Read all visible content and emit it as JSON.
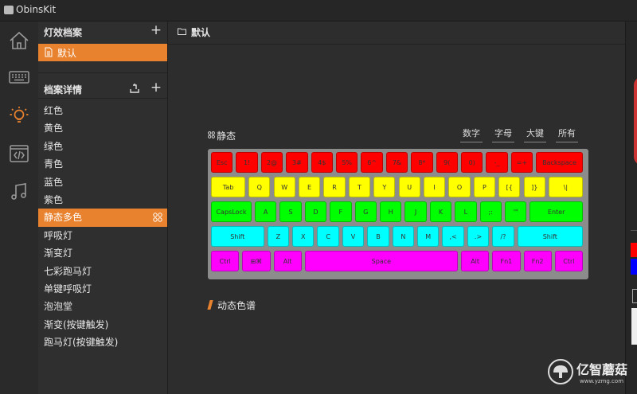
{
  "app": {
    "title": "ObinsKit"
  },
  "nav": [
    {
      "name": "home-icon"
    },
    {
      "name": "keyboard-icon"
    },
    {
      "name": "lightbulb-icon",
      "active": true
    },
    {
      "name": "code-icon"
    },
    {
      "name": "music-note-icon"
    }
  ],
  "profiles": {
    "title": "灯效档案",
    "add": "+",
    "items": [
      "默认"
    ]
  },
  "details": {
    "title": "档案详情",
    "add": "+",
    "effects": [
      "红色",
      "黄色",
      "绿色",
      "青色",
      "蓝色",
      "紫色",
      "静态多色",
      "呼吸灯",
      "渐变灯",
      "七彩跑马灯",
      "单键呼吸灯",
      "泡泡堂",
      "渐变(按键触发)",
      "跑马灯(按键触发)"
    ],
    "active_index": 6
  },
  "main": {
    "title": "默认",
    "static_label": "静态",
    "filters": [
      "数字",
      "字母",
      "大键",
      "所有"
    ],
    "dynamic_label": "动态色谱"
  },
  "colors": {
    "accent": "#e8822e",
    "red": "#ff0000",
    "yellow": "#ffff00",
    "green": "#00ff00",
    "cyan": "#00ffff",
    "magenta": "#ff00ff"
  },
  "keyboard": {
    "rows": [
      {
        "color": "#ff0000",
        "keys": [
          [
            "Esc",
            1
          ],
          [
            "1!",
            1
          ],
          [
            "2@",
            1
          ],
          [
            "3#",
            1
          ],
          [
            "4$",
            1
          ],
          [
            "5%",
            1
          ],
          [
            "6^",
            1
          ],
          [
            "7&",
            1
          ],
          [
            "8*",
            1
          ],
          [
            "9(",
            1
          ],
          [
            "0)",
            1
          ],
          [
            "-_",
            1
          ],
          [
            "=+",
            1
          ],
          [
            "Backspace",
            2
          ]
        ]
      },
      {
        "color": "#ffff00",
        "keys": [
          [
            "Tab",
            1.5
          ],
          [
            "Q",
            1
          ],
          [
            "W",
            1
          ],
          [
            "E",
            1
          ],
          [
            "R",
            1
          ],
          [
            "T",
            1
          ],
          [
            "Y",
            1
          ],
          [
            "U",
            1
          ],
          [
            "I",
            1
          ],
          [
            "O",
            1
          ],
          [
            "P",
            1
          ],
          [
            "[{",
            1
          ],
          [
            "]}",
            1
          ],
          [
            "\\|",
            1.5
          ]
        ]
      },
      {
        "color": "#00ff00",
        "keys": [
          [
            "CapsLock",
            1.75
          ],
          [
            "A",
            1
          ],
          [
            "S",
            1
          ],
          [
            "D",
            1
          ],
          [
            "F",
            1
          ],
          [
            "G",
            1
          ],
          [
            "H",
            1
          ],
          [
            "J",
            1
          ],
          [
            "K",
            1
          ],
          [
            "L",
            1
          ],
          [
            ";:",
            1
          ],
          [
            "'\"",
            1
          ],
          [
            "Enter",
            2.25
          ]
        ]
      },
      {
        "color": "#00ffff",
        "keys": [
          [
            "Shift",
            2.25
          ],
          [
            "Z",
            1
          ],
          [
            "X",
            1
          ],
          [
            "C",
            1
          ],
          [
            "V",
            1
          ],
          [
            "B",
            1
          ],
          [
            "N",
            1
          ],
          [
            "M",
            1
          ],
          [
            ",<",
            1
          ],
          [
            ".>",
            1
          ],
          [
            "/?",
            1
          ],
          [
            "Shift",
            2.75
          ]
        ]
      },
      {
        "color": "#ff00ff",
        "keys": [
          [
            "Ctrl",
            1.25
          ],
          [
            "⊞⌘",
            1.25
          ],
          [
            "Alt",
            1.25
          ],
          [
            "Space",
            6.25
          ],
          [
            "Alt",
            1.25
          ],
          [
            "Fn1",
            1.25
          ],
          [
            "Fn2",
            1.25
          ],
          [
            "Ctrl",
            1.25
          ]
        ]
      }
    ]
  },
  "watermark": {
    "text": "亿智蘑菇",
    "url": "www.yzmg.com"
  }
}
